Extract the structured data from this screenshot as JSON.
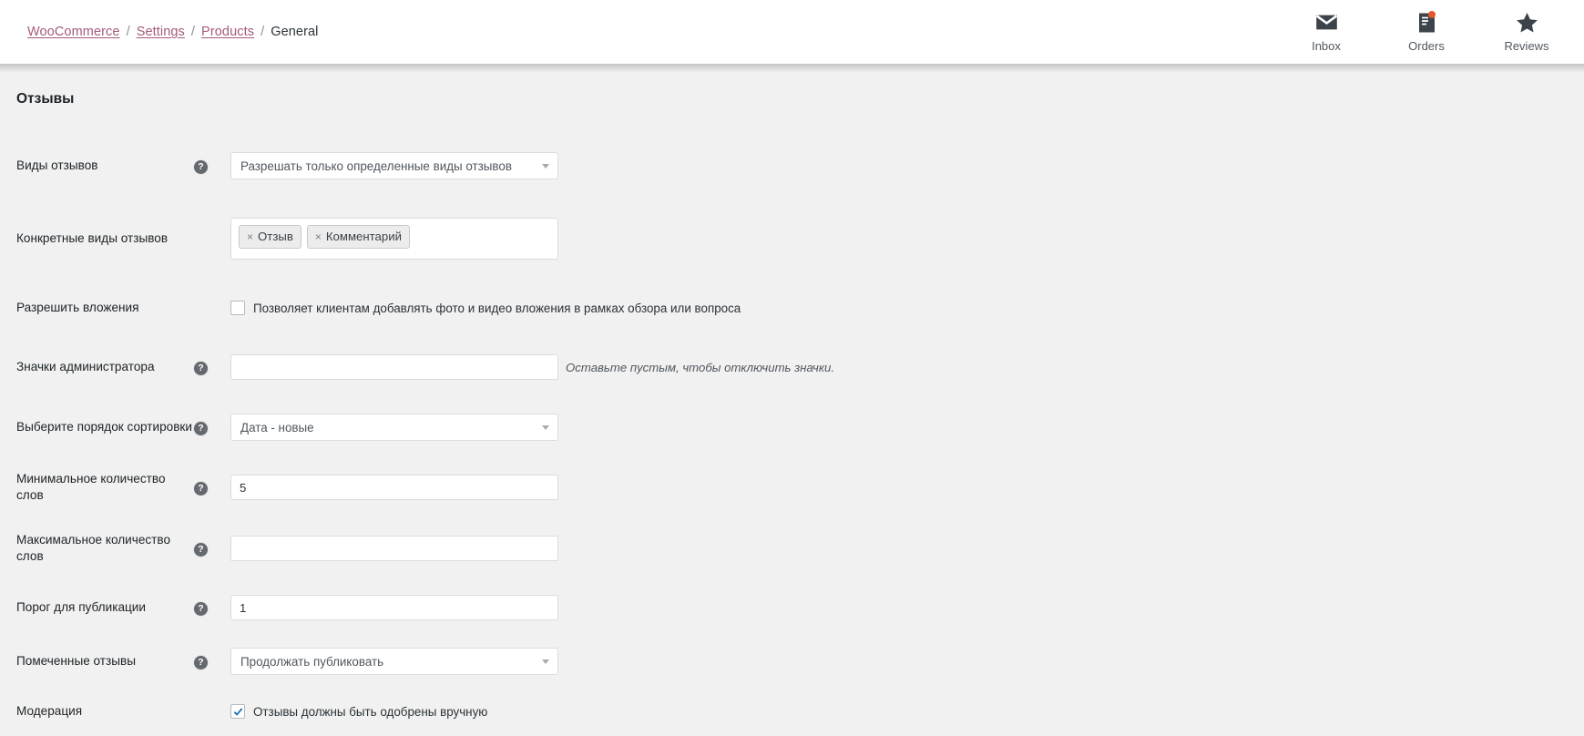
{
  "header": {
    "breadcrumb": [
      {
        "label": "WooCommerce",
        "link": true
      },
      {
        "label": "Settings",
        "link": true
      },
      {
        "label": "Products",
        "link": true
      },
      {
        "label": "General",
        "link": false
      }
    ],
    "separator": "/",
    "actions": [
      {
        "label": "Inbox",
        "icon": "envelope-icon",
        "badge": false
      },
      {
        "label": "Orders",
        "icon": "orders-document-icon",
        "badge": true
      },
      {
        "label": "Reviews",
        "icon": "star-icon",
        "badge": false
      }
    ],
    "link_color": "#a45a7c",
    "badge_color": "#e8552b"
  },
  "section": {
    "title": "Отзывы"
  },
  "fields": {
    "review_types": {
      "label": "Виды отзывов",
      "help": "?",
      "value": "Разрешать только определенные виды отзывов"
    },
    "specific_types": {
      "label": "Конкретные виды отзывов",
      "tokens": [
        {
          "remove": "×",
          "label": "Отзыв"
        },
        {
          "remove": "×",
          "label": "Комментарий"
        }
      ]
    },
    "allow_attachments": {
      "label": "Разрешить вложения",
      "checked": false,
      "description": "Позволяет клиентам добавлять фото и видео вложения в рамках обзора или вопроса"
    },
    "admin_badges": {
      "label": "Значки администратора",
      "help": "?",
      "value": "",
      "placeholder": "",
      "hint": "Оставьте пустым, чтобы отключить значки."
    },
    "sort_order": {
      "label": "Выберите порядок сортировки",
      "help": "?",
      "value": "Дата - новые"
    },
    "min_words": {
      "label": "Минимальное количество слов",
      "help": "?",
      "value": "5"
    },
    "max_words": {
      "label": "Максимальное количество слов",
      "help": "?",
      "value": "",
      "placeholder": ""
    },
    "publish_threshold": {
      "label": "Порог для публикации",
      "help": "?",
      "value": "1"
    },
    "flagged_reviews": {
      "label": "Помеченные отзывы",
      "help": "?",
      "value": "Продолжать публиковать"
    },
    "moderation": {
      "label": "Модерация",
      "checked": true,
      "description": "Отзывы должны быть одобрены вручную"
    }
  }
}
